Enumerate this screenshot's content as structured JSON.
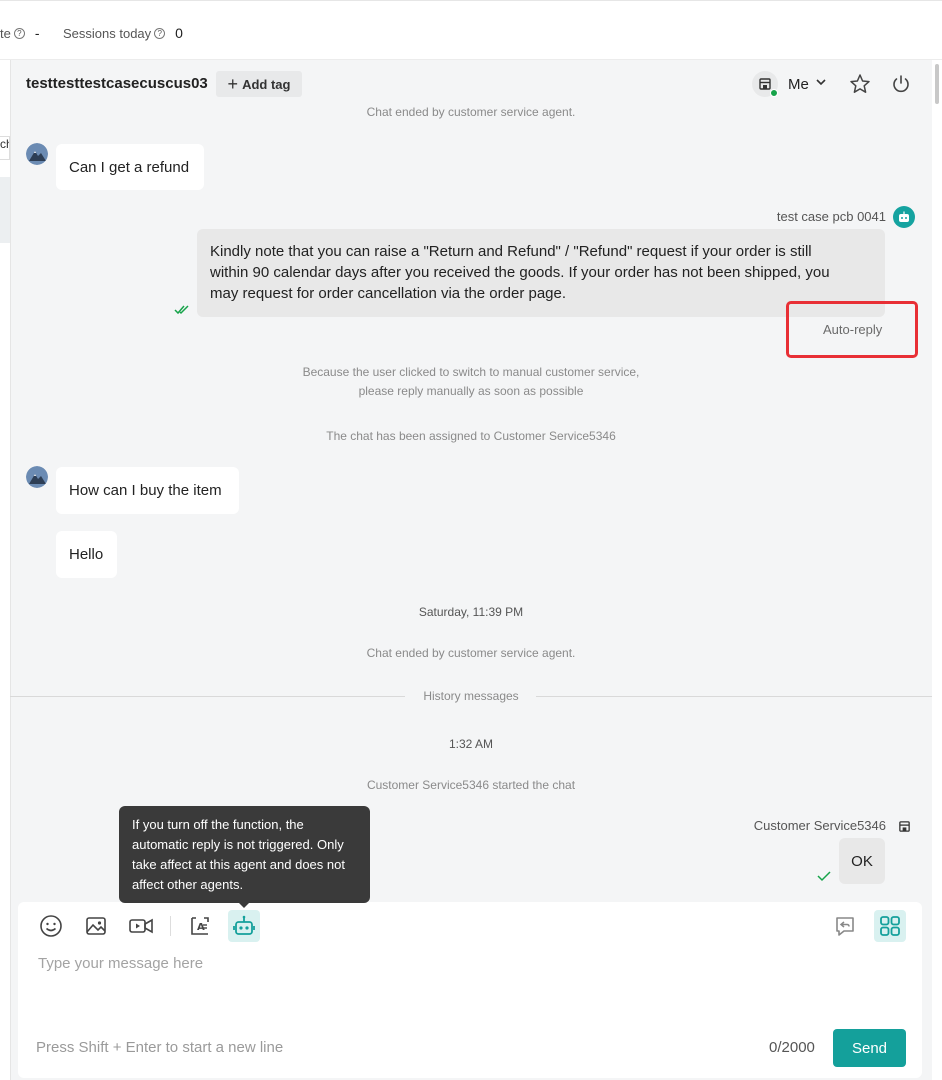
{
  "topbar": {
    "stat1_label": "te",
    "stat1_value": "-",
    "stat2_label": "Sessions today",
    "stat2_value": "0"
  },
  "left_fragment": "ch",
  "header": {
    "customer_name": "testtesttestcasecuscus03",
    "add_tag_label": "Add tag",
    "assignee_label": "Me"
  },
  "messages": {
    "sys_chat_ended_1": "Chat ended by customer service agent.",
    "customer_msg_1": "Can I get a refund",
    "bot_agent_name": "test case pcb 0041",
    "bot_reply_line1": "Kindly note that you can raise a \"Return and Refund\" / \"Refund\" request if your order is still",
    "bot_reply_line2": "within 90 calendar days after you received the goods. If your order has not been shipped, you",
    "bot_reply_line3": "may request for order cancellation via the order page.",
    "auto_reply_label": "Auto-reply",
    "sys_manual_line1": "Because the user clicked to switch to manual customer service,",
    "sys_manual_line2": "please reply manually as soon as possible",
    "sys_assigned": "The chat has been assigned to Customer Service5346",
    "customer_msg_2": "How can I buy the item",
    "customer_msg_3": "Hello",
    "timestamp_1": "Saturday, 11:39 PM",
    "sys_chat_ended_2": "Chat ended by customer service agent.",
    "history_label": "History messages",
    "timestamp_2": "1:32 AM",
    "sys_started": "Customer Service5346 started the chat",
    "agent_name": "Customer Service5346",
    "agent_msg_1": "OK"
  },
  "tooltip": {
    "line1": "If you turn off the function, the",
    "line2": "automatic reply is not triggered. Only",
    "line3": "take affect at this agent and does not",
    "line4": "affect other agents."
  },
  "composer": {
    "placeholder": "Type your message here",
    "hint": "Press Shift + Enter to start a new line",
    "counter": "0/2000",
    "send_label": "Send"
  },
  "colors": {
    "accent": "#14a09b",
    "highlight_box": "#e82f35",
    "online_dot": "#16a34a"
  },
  "icons": [
    "question-icon",
    "store-icon",
    "chevron-down-icon",
    "star-icon",
    "power-icon",
    "robot-icon",
    "double-check-icon",
    "check-icon",
    "emoji-icon",
    "image-icon",
    "video-icon",
    "ai-text-icon",
    "quick-reply-icon",
    "apps-grid-icon",
    "plus-icon"
  ]
}
